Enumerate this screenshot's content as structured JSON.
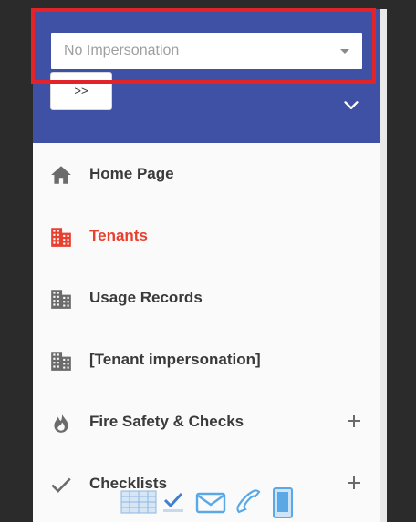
{
  "impersonation": {
    "selected": "No Impersonation",
    "go_label": ">>"
  },
  "menu": {
    "items": [
      {
        "label": "Home Page",
        "icon": "home-icon",
        "active": false,
        "expandable": false
      },
      {
        "label": "Tenants",
        "icon": "building-icon",
        "active": true,
        "expandable": false
      },
      {
        "label": "Usage Records",
        "icon": "building-icon",
        "active": false,
        "expandable": false
      },
      {
        "label": "[Tenant impersonation]",
        "icon": "building-icon",
        "active": false,
        "expandable": false
      },
      {
        "label": "Fire Safety & Checks",
        "icon": "fire-icon",
        "active": false,
        "expandable": true
      },
      {
        "label": "Checklists",
        "icon": "check-icon",
        "active": false,
        "expandable": true
      }
    ]
  },
  "colors": {
    "header": "#3f51a5",
    "active": "#e8402f",
    "text": "#3a3a3a",
    "icon": "#6b6b6b",
    "highlight": "#e2242a",
    "footer_icon": "#5aa9e6"
  },
  "footer": {
    "icons": [
      "table-icon",
      "checkmark-logo-icon",
      "envelope-icon",
      "phone-icon",
      "mobile-icon"
    ]
  }
}
